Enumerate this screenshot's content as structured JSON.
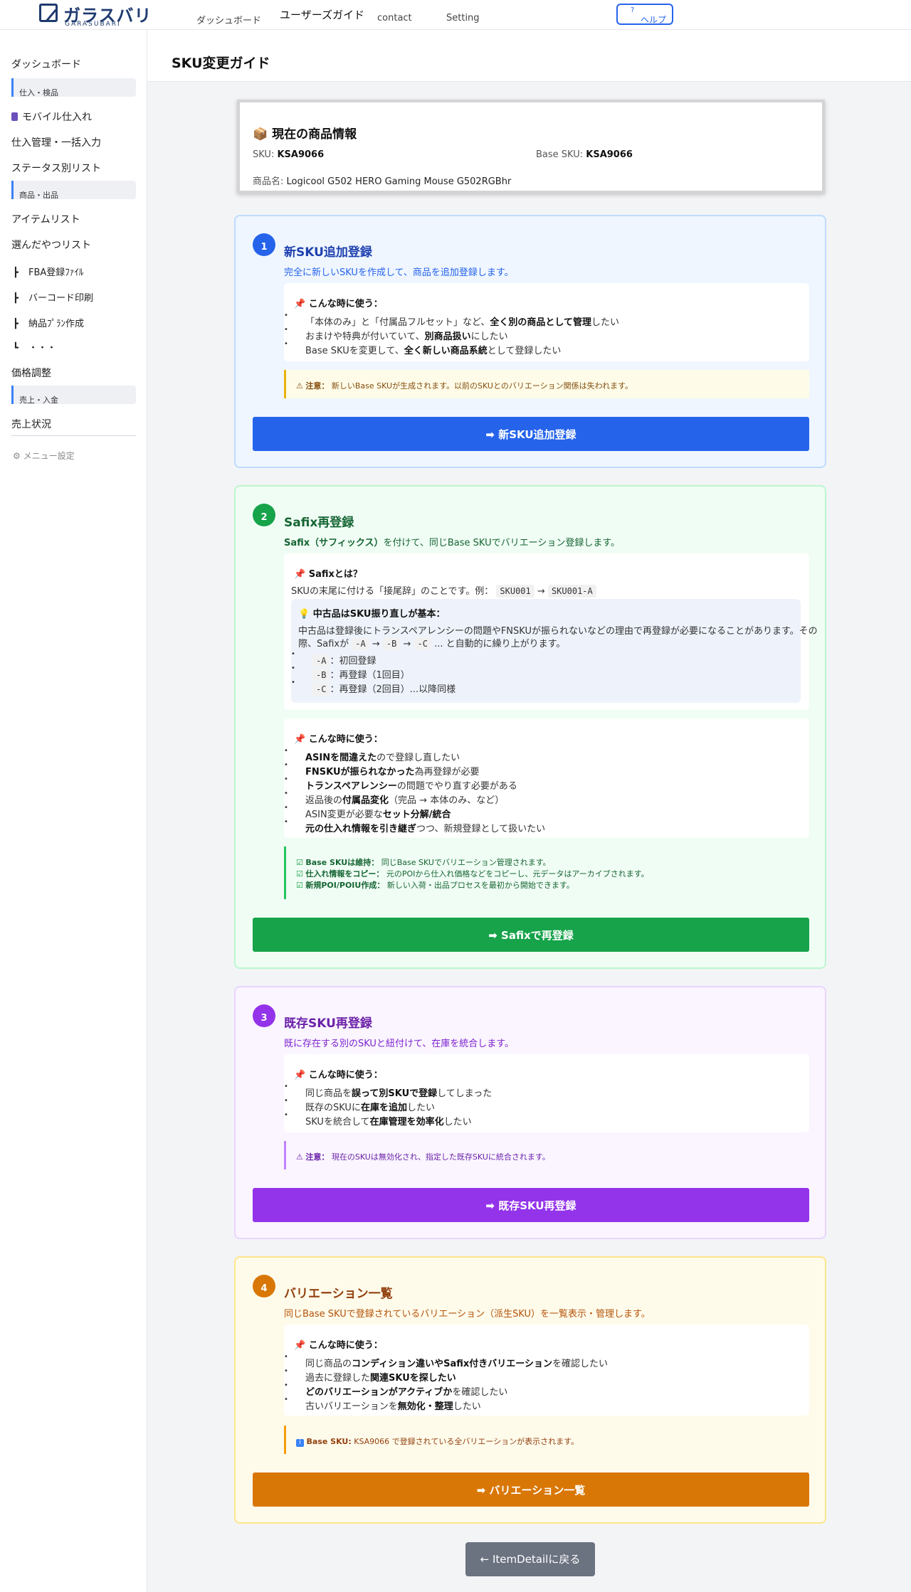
{
  "header": {
    "logo_text": "ガラスバリ",
    "logo_sub": "GARASUBARI",
    "nav": [
      "ダッシュボード",
      "ユーザーズガイド",
      "contact",
      "Setting"
    ],
    "help_q": "?",
    "help_label": "ヘルプ"
  },
  "sidebar": {
    "dashboard": "ダッシュボード",
    "group1": "仕入・検品",
    "mobile": "モバイル仕入れ",
    "bulk": "仕入管理・一括入力",
    "status": "ステータス別リスト",
    "group2": "商品・出品",
    "itemlist": "アイテムリスト",
    "picked": "選んだやつリスト",
    "fba": "FBA登録ﾌｧｲﾙ",
    "barcode": "バーコード印刷",
    "delivery": "納品ﾌﾟﾗﾝ作成",
    "more": "・・・",
    "price": "価格調整",
    "group3": "売上・入金",
    "sales": "売上状況",
    "settings": "メニュー設定"
  },
  "page": {
    "title": "SKU変更ガイド",
    "back": "← ItemDetailに戻る"
  },
  "product": {
    "title": "現在の商品情報",
    "sku_label": "SKU:",
    "sku": "KSA9066",
    "base_label": "Base SKU:",
    "base_sku": "KSA9066",
    "name_label": "商品名:",
    "name": "Logicool G502 HERO Gaming Mouse G502RGBhr"
  },
  "card1": {
    "num": "1",
    "title": "新SKU追加登録",
    "desc": "完全に新しいSKUを作成して、商品を追加登録します。",
    "head": "こんな時に使う：",
    "items": [
      [
        "「本体のみ」と「付属品フルセット」など、",
        "全く別の商品として管理",
        "したい"
      ],
      [
        "おまけや特典が付いていて、",
        "別商品扱い",
        "にしたい"
      ],
      [
        "Base SKUを変更して、",
        "全く新しい商品系統",
        "として登録したい"
      ]
    ],
    "note_label": "注意：",
    "note": "新しいBase SKUが生成されます。以前のSKUとのバリエーション関係は失われます。",
    "button": "➡ 新SKU追加登録"
  },
  "card2": {
    "num": "2",
    "title": "Safix再登録",
    "desc_b": "Safix（サフィックス）",
    "desc": "を付けて、同じBase SKUでバリエーション登録します。",
    "what_head": "Safixとは？",
    "what_text": "SKUの末尾に付ける「接尾辞」のことです。例：",
    "ex1": "SKU001",
    "arrow": "→",
    "ex2": "SKU001-A",
    "tip_head": "中古品はSKU振り直しが基本：",
    "tip_text1": "中古品は登録後にトランスペアレンシーの問題やFNSKUが振られないなどの理由で再登録が必要になることがあります。その",
    "tip_text2a": "際、Safixが",
    "tip_codes": [
      "-A",
      "-B",
      "-C"
    ],
    "tip_text2b": "... と自動的に繰り上がります。",
    "tip_items": [
      [
        "-A",
        "：初回登録"
      ],
      [
        "-B",
        "：再登録（1回目）"
      ],
      [
        "-C",
        "：再登録（2回目）...以降同様"
      ]
    ],
    "head": "こんな時に使う：",
    "items": [
      [
        "",
        "ASINを間違えた",
        "ので登録し直したい"
      ],
      [
        "",
        "FNSKUが振られなかった",
        "為再登録が必要"
      ],
      [
        "",
        "トランスペアレンシー",
        "の問題でやり直す必要がある"
      ],
      [
        "返品後の",
        "付属品変化",
        "（完品 → 本体のみ、など）"
      ],
      [
        "ASIN変更が必要な",
        "セット分解/統合",
        ""
      ],
      [
        "",
        "元の仕入れ情報を引き継ぎ",
        "つつ、新規登録として扱いたい"
      ]
    ],
    "checks": [
      [
        "Base SKUは維持：",
        "同じBase SKUでバリエーション管理されます。"
      ],
      [
        "仕入れ情報をコピー：",
        "元のPOIから仕入れ価格などをコピーし、元データはアーカイブされます。"
      ],
      [
        "新規POI/POIU作成：",
        "新しい入荷・出品プロセスを最初から開始できます。"
      ]
    ],
    "button": "➡ Safixで再登録"
  },
  "card3": {
    "num": "3",
    "title": "既存SKU再登録",
    "desc": "既に存在する別のSKUと紐付けて、在庫を統合します。",
    "head": "こんな時に使う：",
    "items": [
      [
        "同じ商品を",
        "誤って別SKUで登録",
        "してしまった"
      ],
      [
        "既存のSKUに",
        "在庫を追加",
        "したい"
      ],
      [
        "SKUを統合して",
        "在庫管理を効率化",
        "したい"
      ]
    ],
    "note_label": "注意：",
    "note": "現在のSKUは無効化され、指定した既存SKUに統合されます。",
    "button": "➡ 既存SKU再登録"
  },
  "card4": {
    "num": "4",
    "title": "バリエーション一覧",
    "desc": "同じBase SKUで登録されているバリエーション（派生SKU）を一覧表示・管理します。",
    "head": "こんな時に使う：",
    "items": [
      [
        "同じ商品の",
        "コンディション違いやSafix付きバリエーション",
        "を確認したい"
      ],
      [
        "過去に登録した",
        "関連SKUを探したい",
        ""
      ],
      [
        "",
        "どのバリエーションがアクティブか",
        "を確認したい"
      ],
      [
        "古いバリエーションを",
        "無効化・整理",
        "したい"
      ]
    ],
    "note_label": "Base SKU:",
    "note_sku": "KSA9066",
    "note": "で登録されている全バリエーションが表示されます。",
    "button": "➡ バリエーション一覧"
  },
  "colors": {
    "blue": "#2563eb",
    "green": "#16a34a",
    "purple": "#9333ea",
    "orange": "#d97706"
  },
  "icons": [
    "package-icon",
    "pin-icon",
    "warning-icon",
    "bulb-icon",
    "check-icon",
    "info-icon",
    "arrow-icon",
    "phone-icon",
    "gear-icon"
  ]
}
